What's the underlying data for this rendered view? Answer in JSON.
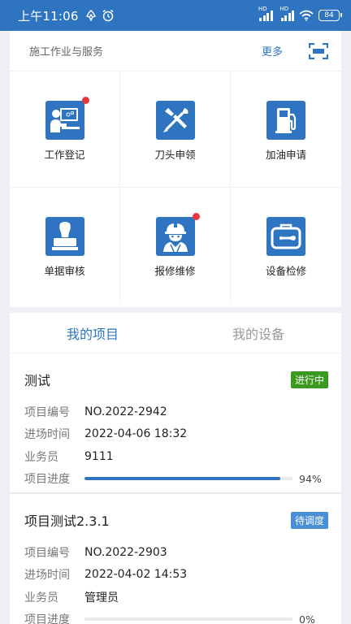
{
  "status_bar": {
    "time": "上午11:06",
    "battery": "84",
    "hd1": "HD",
    "hd2": "HD"
  },
  "services": {
    "title": "施工作业与服务",
    "more_label": "更多",
    "items": [
      {
        "label": "工作登记",
        "icon": "work-register-icon",
        "dot": true
      },
      {
        "label": "刀头申领",
        "icon": "tool-apply-icon",
        "dot": false
      },
      {
        "label": "加油申请",
        "icon": "fuel-apply-icon",
        "dot": false
      },
      {
        "label": "单据审核",
        "icon": "doc-review-icon",
        "dot": false
      },
      {
        "label": "报修维修",
        "icon": "repair-worker-icon",
        "dot": true
      },
      {
        "label": "设备检修",
        "icon": "equipment-check-icon",
        "dot": false
      }
    ]
  },
  "tabs": [
    {
      "label": "我的项目",
      "active": true
    },
    {
      "label": "我的设备",
      "active": false
    }
  ],
  "projects": [
    {
      "title": "测试",
      "status": "进行中",
      "status_color": "#3a9a1f",
      "fields": [
        {
          "key": "项目编号",
          "value": "NO.2022-2942"
        },
        {
          "key": "进场时间",
          "value": "2022-04-06 18:32"
        },
        {
          "key": "业务员",
          "value": "9111"
        }
      ],
      "progress_key": "项目进度",
      "progress": 94,
      "progress_label": "94%"
    },
    {
      "title": "项目测试2.3.1",
      "status": "待调度",
      "status_color": "#4a8fd6",
      "fields": [
        {
          "key": "项目编号",
          "value": "NO.2022-2903"
        },
        {
          "key": "进场时间",
          "value": "2022-04-02 14:53"
        },
        {
          "key": "业务员",
          "value": "管理员"
        }
      ],
      "progress_key": "项目进度",
      "progress": 0,
      "progress_label": "0%"
    }
  ],
  "colors": {
    "brand": "#2f74c0",
    "dot": "#e8383d"
  }
}
